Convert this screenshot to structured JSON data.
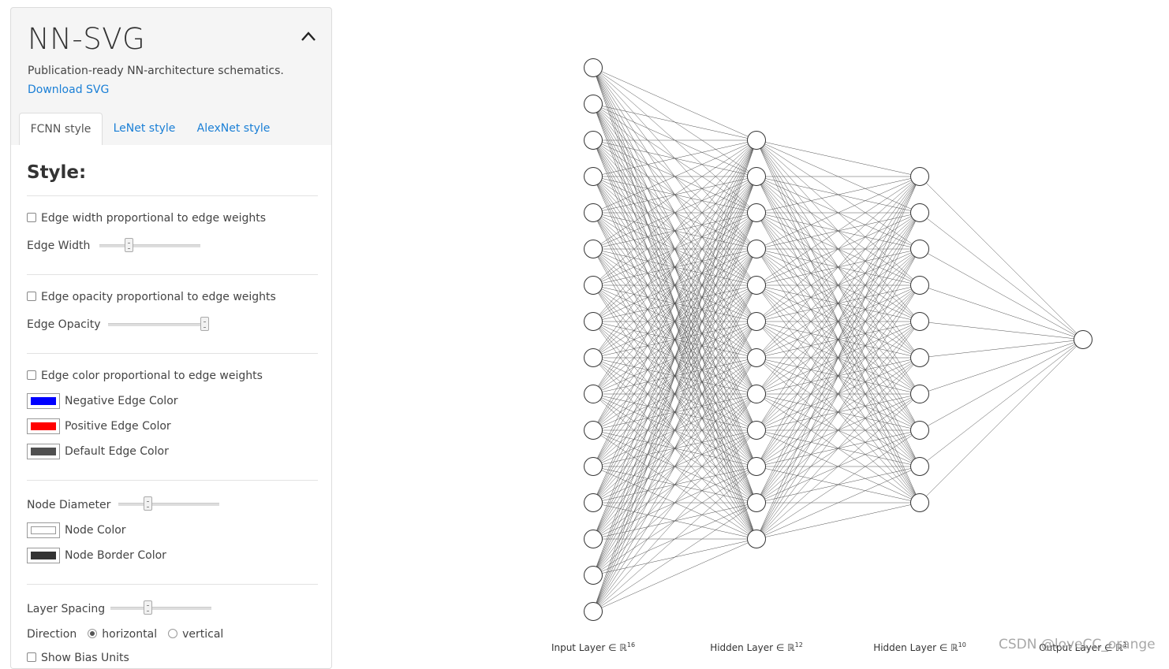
{
  "app": {
    "title": "NN-SVG",
    "tagline": "Publication-ready NN-architecture schematics.",
    "download_label": "Download SVG"
  },
  "tabs": [
    {
      "label": "FCNN style",
      "active": true
    },
    {
      "label": "LeNet style",
      "active": false
    },
    {
      "label": "AlexNet style",
      "active": false
    }
  ],
  "style": {
    "title": "Style:",
    "edge_width_prop_label": "Edge width proportional to edge weights",
    "edge_width_label": "Edge Width",
    "edge_width_value": 0.27,
    "edge_opacity_prop_label": "Edge opacity proportional to edge weights",
    "edge_opacity_label": "Edge Opacity",
    "edge_opacity_value": 1.0,
    "edge_color_prop_label": "Edge color proportional to edge weights",
    "negative_edge_color_label": "Negative Edge Color",
    "negative_edge_color": "#0000ff",
    "positive_edge_color_label": "Positive Edge Color",
    "positive_edge_color": "#ff0000",
    "default_edge_color_label": "Default Edge Color",
    "default_edge_color": "#505050",
    "node_diameter_label": "Node Diameter",
    "node_diameter_value": 0.27,
    "node_color_label": "Node Color",
    "node_color": "#ffffff",
    "node_border_color_label": "Node Border Color",
    "node_border_color": "#333333",
    "layer_spacing_label": "Layer Spacing",
    "layer_spacing_value": 0.36,
    "direction_label": "Direction",
    "direction_options": [
      "horizontal",
      "vertical"
    ],
    "direction_selected": "horizontal",
    "bias_label": "Show Bias Units"
  },
  "network": {
    "layers": [
      {
        "label": "Input Layer ∈ ℝ",
        "exponent": "16",
        "units": 16
      },
      {
        "label": "Hidden Layer ∈ ℝ",
        "exponent": "12",
        "units": 12
      },
      {
        "label": "Hidden Layer ∈ ℝ",
        "exponent": "10",
        "units": 10
      },
      {
        "label": "Output Layer ∈ ℝ",
        "exponent": "1",
        "units": 1
      }
    ],
    "edge_color": "#505050",
    "node_fill": "#ffffff",
    "node_stroke": "#333333"
  },
  "icons": {
    "collapse": "chevron-up-icon"
  },
  "watermark": "CSDN @loveCC_orange"
}
